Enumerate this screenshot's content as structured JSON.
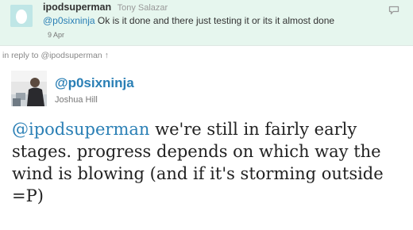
{
  "reply": {
    "screen_name": "ipodsuperman",
    "real_name": "Tony Salazar",
    "mention": "@p0sixninja",
    "text": " Ok is it done and there just testing it or its it almost done",
    "date": "9 Apr"
  },
  "in_reply_to": {
    "label": "in reply to @ipodsuperman",
    "arrow": "↑"
  },
  "tweet": {
    "screen_name": "@p0sixninja",
    "real_name": "Joshua Hill",
    "mention": "@ipodsuperman",
    "text": " we're still in fairly early stages. progress depends on which way the wind is blowing (and if it's storming outside =P)"
  },
  "icons": {
    "comment": "speech-bubble-icon",
    "egg_avatar": "egg-avatar",
    "photo_avatar": "photo-avatar"
  },
  "colors": {
    "reply_background": "#e6f6ee",
    "link": "#2a7fb5"
  }
}
